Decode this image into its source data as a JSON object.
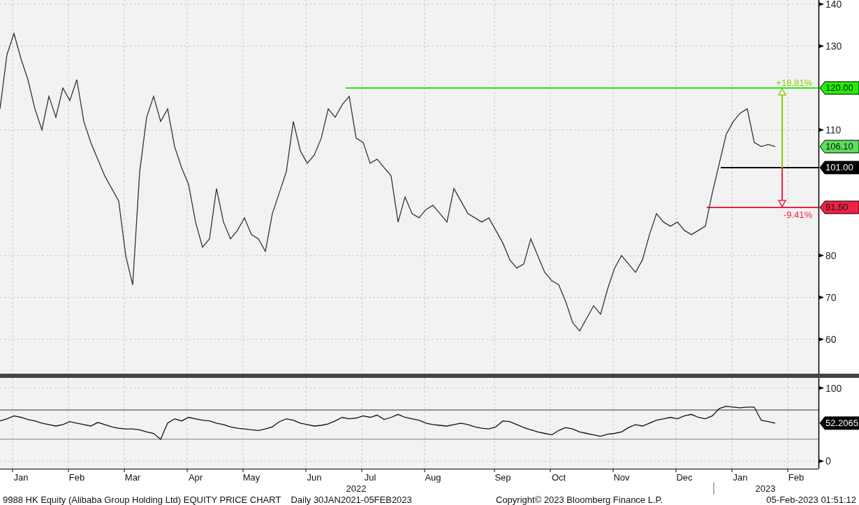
{
  "price_panel": {
    "chart_data": {
      "type": "line",
      "grid": true,
      "series": [
        {
          "color": "#333333",
          "values": [
            115,
            128,
            133,
            127,
            122,
            115,
            110,
            118,
            113,
            120,
            117,
            122,
            112,
            107,
            103,
            99,
            96,
            93,
            80,
            73,
            100,
            113,
            118,
            112,
            115,
            106,
            101,
            97,
            88,
            82,
            84,
            96,
            88,
            84,
            86,
            89,
            85,
            84,
            81,
            90,
            95,
            100,
            112,
            105,
            102,
            104,
            108,
            115,
            113,
            116,
            118,
            108,
            107,
            102,
            103,
            101,
            99,
            88,
            94,
            90,
            89,
            91,
            92,
            90,
            88,
            96,
            93,
            90,
            89,
            88,
            89,
            86,
            83,
            79,
            77,
            78,
            84,
            80,
            76,
            74,
            73,
            69,
            64,
            62,
            65,
            68,
            66,
            72,
            77,
            80,
            78,
            76,
            79,
            85,
            90,
            88,
            87,
            88,
            86,
            85,
            86,
            87,
            95,
            102,
            109,
            112,
            114,
            115,
            107,
            106,
            106.5,
            106
          ]
        }
      ],
      "ylim": [
        51.8,
        141
      ],
      "yticks": [
        60,
        70,
        80,
        110,
        130,
        140
      ],
      "ref_lines": [
        {
          "axis": "y",
          "value": 120,
          "label": "120.00",
          "color": "#22ee00"
        },
        {
          "axis": "y",
          "value": 101,
          "label": "101.00",
          "color": "#000000"
        },
        {
          "axis": "y",
          "value": 91.5,
          "label": "91.50",
          "color": "#ee2244"
        }
      ],
      "annotations": [
        "106.10",
        "+18.81%",
        "-9.41%"
      ]
    }
  },
  "rsi_panel": {
    "chart_data": {
      "type": "line",
      "grid": true,
      "categories": [
        null,
        null,
        null,
        "Jan",
        null,
        null,
        null,
        null,
        null,
        null,
        null,
        "Feb",
        null,
        null,
        null,
        null,
        null,
        null,
        null,
        "Mar",
        null,
        null,
        null,
        null,
        null,
        null,
        null,
        null,
        "Apr",
        null,
        null,
        null,
        null,
        null,
        null,
        null,
        "May",
        null,
        null,
        null,
        null,
        null,
        null,
        null,
        null,
        "Jun",
        null,
        null,
        null,
        null,
        null,
        null,
        null,
        "Jul",
        null,
        null,
        null,
        null,
        null,
        null,
        null,
        null,
        "Aug",
        null,
        null,
        null,
        null,
        null,
        null,
        null,
        null,
        null,
        "Sep",
        null,
        null,
        null,
        null,
        null,
        null,
        null,
        "Oct",
        null,
        null,
        null,
        null,
        null,
        null,
        null,
        null,
        "Nov",
        null,
        null,
        null,
        null,
        null,
        null,
        null,
        null,
        "Dec",
        null,
        null,
        null,
        null,
        null,
        null,
        null,
        "Jan",
        null,
        null,
        null,
        null,
        null,
        null,
        null,
        "Feb",
        null,
        null
      ],
      "series": [
        {
          "color": "#111111",
          "values": [
            55,
            58,
            62,
            60,
            57,
            55,
            52,
            50,
            48,
            50,
            54,
            52,
            50,
            48,
            53,
            50,
            47,
            45,
            44,
            44,
            43,
            40,
            38,
            30,
            52,
            58,
            55,
            60,
            58,
            56,
            55,
            52,
            50,
            47,
            45,
            44,
            43,
            42,
            44,
            47,
            54,
            58,
            56,
            52,
            50,
            48,
            49,
            51,
            55,
            60,
            58,
            59,
            62,
            60,
            63,
            57,
            60,
            64,
            60,
            58,
            56,
            52,
            50,
            49,
            48,
            50,
            52,
            50,
            47,
            45,
            44,
            47,
            55,
            54,
            50,
            46,
            43,
            40,
            38,
            36,
            42,
            46,
            44,
            40,
            38,
            36,
            34,
            37,
            38,
            40,
            46,
            50,
            48,
            52,
            56,
            58,
            60,
            58,
            62,
            64,
            60,
            58,
            62,
            72,
            75,
            74,
            73,
            74,
            74,
            56,
            54,
            52,
            null,
            null,
            null,
            null,
            null
          ]
        }
      ],
      "ylim": [
        -10.2,
        113.9
      ],
      "yticks": [
        0,
        100
      ],
      "ref_lines": [
        {
          "axis": "y",
          "value": 70,
          "color": "#333333"
        },
        {
          "axis": "y",
          "value": 30,
          "color": "#777777"
        }
      ],
      "annotations": [
        "52.2065"
      ]
    }
  },
  "x_axis": {
    "years": [
      "2022",
      "2023"
    ]
  },
  "footer": {
    "title": "9988 HK Equity (Alibaba Group Holding Ltd) EQUITY PRICE CHART",
    "period": "Daily 30JAN2021-05FEB2023",
    "copyright": "Copyright© 2023 Bloomberg Finance L.P.",
    "timestamp": "05-Feb-2023 01:51:12"
  }
}
